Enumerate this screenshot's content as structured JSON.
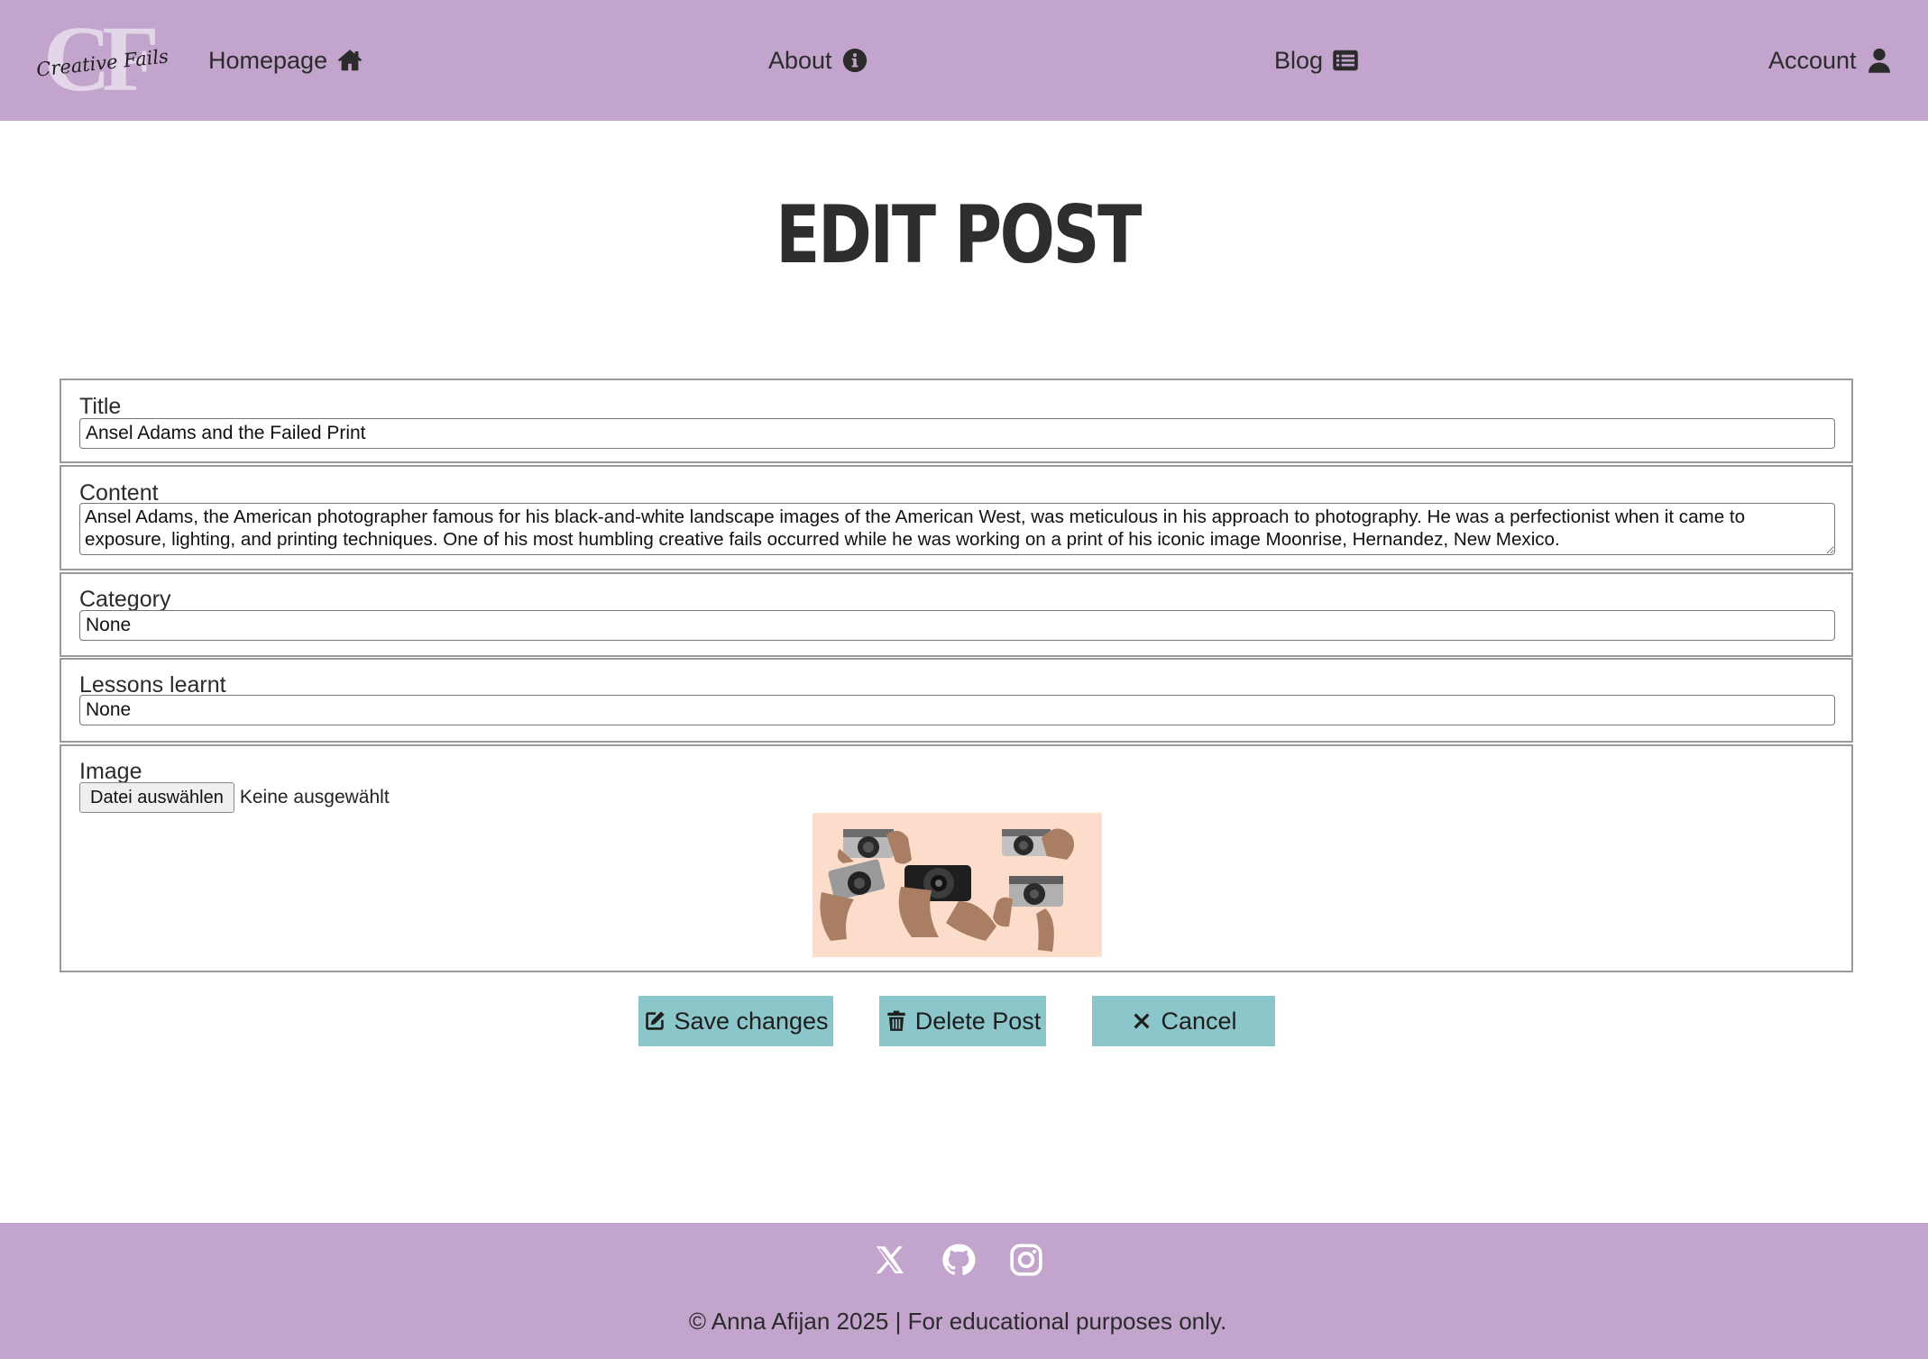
{
  "brand": {
    "monogram": "CF",
    "script_name": "Creative Fails"
  },
  "nav": {
    "home": "Homepage",
    "about": "About",
    "blog": "Blog",
    "account": "Account"
  },
  "page_title": "EDIT POST",
  "form": {
    "title_label": "Title",
    "title_value": "Ansel Adams and the Failed Print",
    "content_label": "Content",
    "content_value": "Ansel Adams, the American photographer famous for his black-and-white landscape images of the American West, was meticulous in his approach to photography. He was a perfectionist when it came to exposure, lighting, and printing techniques. One of his most humbling creative fails occurred while he was working on a print of his iconic image Moonrise, Hernandez, New Mexico.",
    "category_label": "Category",
    "category_value": "None",
    "lessons_label": "Lessons learnt",
    "lessons_value": "None",
    "image_label": "Image",
    "file_button": "Datei auswählen",
    "file_status": "Keine ausgewählt"
  },
  "buttons": {
    "save": "Save changes",
    "delete": "Delete Post",
    "cancel": "Cancel"
  },
  "footer": {
    "social": [
      "x-icon",
      "github-icon",
      "instagram-icon"
    ],
    "copyright": "© Anna Afijan 2025 | For educational purposes only."
  },
  "colors": {
    "header_bg": "#c3a4cd",
    "button_bg": "#8bc6ca",
    "preview_bg": "#fcdccb"
  }
}
